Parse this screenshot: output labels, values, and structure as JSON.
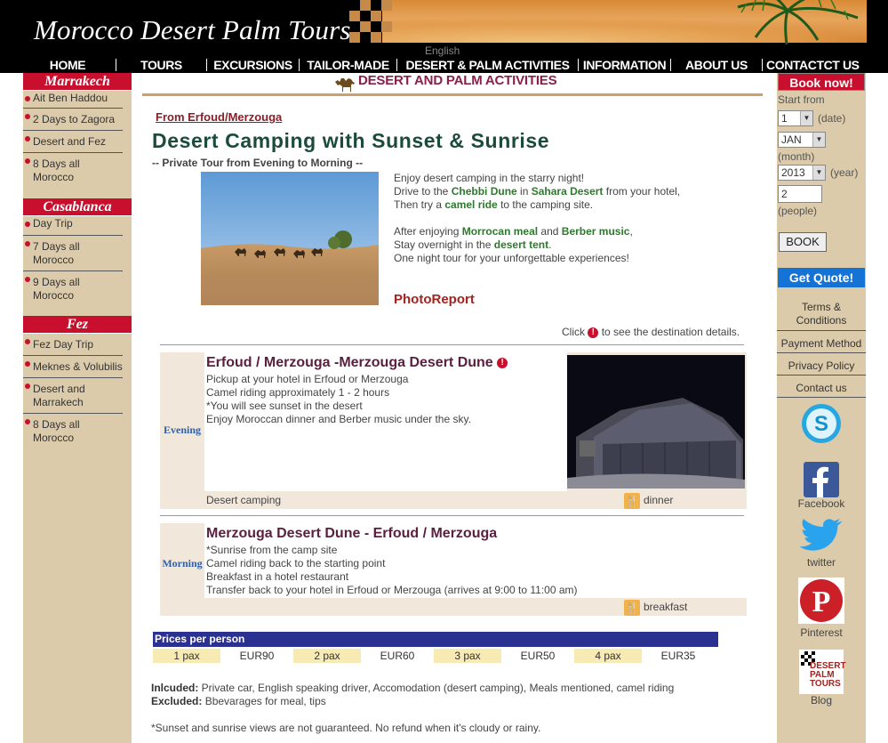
{
  "header": {
    "brand": "Morocco Desert Palm Tours",
    "language": "English",
    "nav": [
      "HOME",
      "TOURS",
      "EXCURSIONS",
      "TAILOR-MADE",
      "DESERT & PALM ACTIVITIES",
      "INFORMATION",
      "ABOUT US",
      "CONTACTCT US"
    ]
  },
  "left": {
    "marrakech": {
      "title": "Marrakech",
      "items": [
        "Ait Ben Haddou",
        "2 Days to Zagora",
        "Desert and Fez",
        "8 Days all Morocco"
      ]
    },
    "casablanca": {
      "title": "Casablanca",
      "items": [
        "Day Trip",
        "7 Days all Morocco",
        "9 Days all Morocco"
      ]
    },
    "fez": {
      "title": "Fez",
      "items": [
        "Fez Day Trip",
        "Meknes & Volubilis",
        "Desert and Marrakech",
        "8 Days all Morocco"
      ]
    }
  },
  "right": {
    "book_now": "Book now!",
    "start_from": "Start from",
    "date_val": "1",
    "date_lbl": "(date)",
    "month_val": "JAN",
    "month_lbl": "(month)",
    "year_val": "2013",
    "year_lbl": "(year)",
    "people_val": "2",
    "people_lbl": "(people)",
    "book_btn": "BOOK",
    "quote": "Get Quote!",
    "links": [
      "Terms & Conditions",
      "Payment Method",
      "Privacy Policy",
      "Contact us"
    ],
    "social": [
      "Facebook",
      "twitter",
      "Pinterest",
      "Blog"
    ],
    "blog_logo": [
      "DESERT",
      "PALM",
      "TOURS"
    ]
  },
  "main": {
    "section_title": "DESERT AND PALM ACTIVITIES",
    "from": "From Erfoud/Merzouga",
    "title": "Desert Camping with Sunset & Sunrise",
    "subtitle": "-- Private Tour from Evening to Morning --",
    "intro": {
      "l1": "Enjoy desert camping in the starry night!",
      "l2a": "Drive to the ",
      "l2b": "Chebbi Dune",
      "l2c": " in ",
      "l2d": "Sahara Desert",
      "l2e": " from your hotel,",
      "l3a": "Then try a ",
      "l3b": "camel ride",
      "l3c": " to the camping site.",
      "l4a": "After enjoying ",
      "l4b": "Morrocan meal",
      "l4c": " and ",
      "l4d": "Berber music",
      "l4e": ",",
      "l5a": "Stay overnight in the ",
      "l5b": "desert tent",
      "l5c": ".",
      "l6": "One night tour for your unforgettable experiences!"
    },
    "photoreport": "PhotoReport",
    "click_a": "Click",
    "click_b": "to see the destination details.",
    "evening": {
      "time": "Evening",
      "title": "Erfoud / Merzouga -Merzouga Desert Dune",
      "lines": [
        "Pickup at your hotel in Erfoud or Merzouga",
        "Camel riding approximately 1 - 2 hours",
        "*You will see sunset in the desert",
        "Enjoy Moroccan dinner and Berber music under the sky."
      ],
      "foot": "Desert camping",
      "meal": "dinner"
    },
    "morning": {
      "time": "Morning",
      "title": "Merzouga Desert Dune - Erfoud / Merzouga",
      "lines": [
        "*Sunrise from the camp site",
        "Camel riding back to the starting point",
        "Breakfast in a hotel restaurant",
        "Transfer back to your hotel in Erfoud or Merzouga (arrives at 9:00 to 11:00 am)"
      ],
      "meal": "breakfast"
    },
    "prices": {
      "header": "Prices per person",
      "pax": [
        "1 pax",
        "2 pax",
        "3 pax",
        "4 pax"
      ],
      "eur": [
        "EUR90",
        "EUR60",
        "EUR50",
        "EUR35"
      ]
    },
    "included_lbl": "Inlcuded:",
    "included": " Private car, English speaking driver, Accomodation (desert camping), Meals mentioned, camel riding",
    "excluded_lbl": "Excluded:",
    "excluded": " Bbevarages for meal, tips",
    "disclaimer": "*Sunset and sunrise views are not guaranteed. No refund when it's cloudy or rainy."
  }
}
